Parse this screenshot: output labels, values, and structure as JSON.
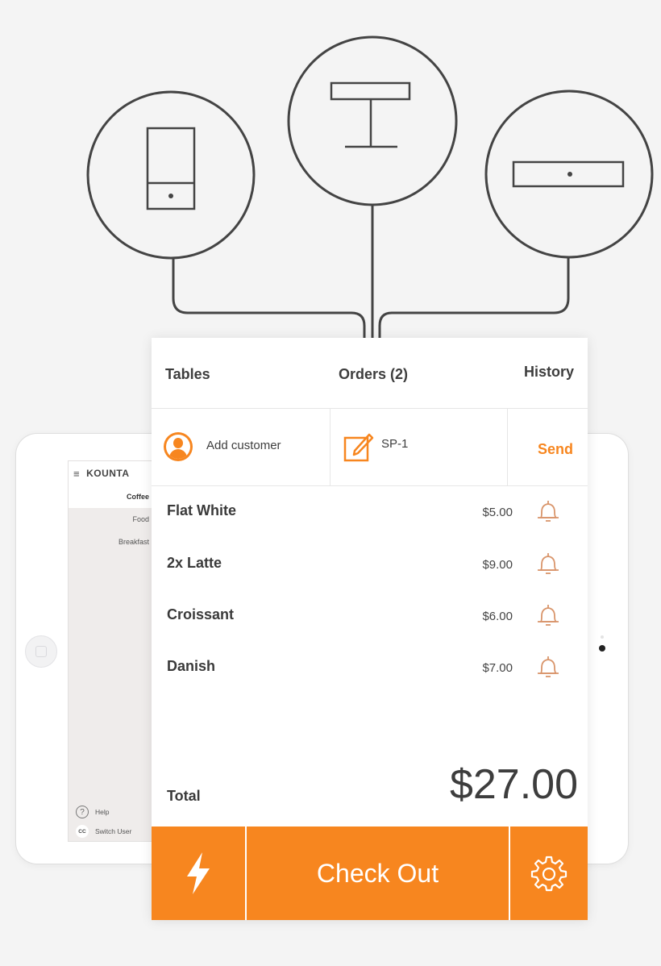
{
  "tabs": {
    "tables": "Tables",
    "orders": "Orders (2)",
    "history": "History"
  },
  "customer": {
    "add_label": "Add customer",
    "order_code": "SP-1",
    "send_label": "Send"
  },
  "items": [
    {
      "name": "Flat White",
      "price": "$5.00"
    },
    {
      "name": "2x Latte",
      "price": "$9.00"
    },
    {
      "name": "Croissant",
      "price": "$6.00"
    },
    {
      "name": "Danish",
      "price": "$7.00"
    }
  ],
  "total": {
    "label": "Total",
    "value": "$27.00"
  },
  "footer": {
    "checkout_label": "Check Out",
    "quick_icon": "lightning-icon",
    "settings_icon": "gear-icon"
  },
  "sidebar": {
    "brand": "KOUNTA",
    "categories": [
      "Coffee",
      "Food",
      "Breakfast"
    ],
    "help_label": "Help",
    "switch_user_label": "Switch User",
    "user_initials": "CC"
  },
  "colors": {
    "accent": "#f7861f",
    "text": "#3a3a3a",
    "background": "#f4f4f4"
  }
}
